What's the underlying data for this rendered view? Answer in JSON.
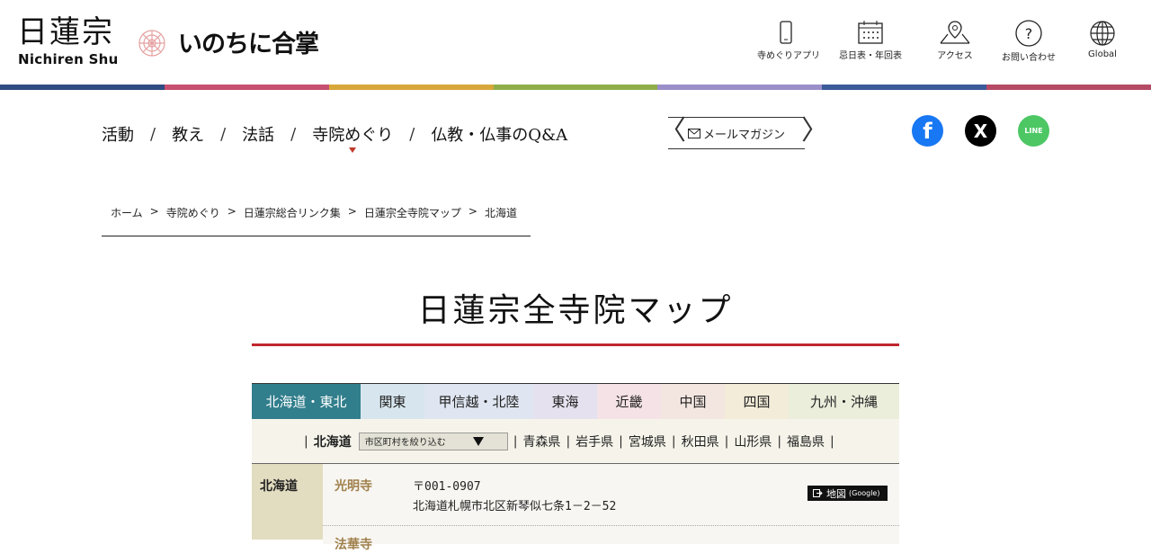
{
  "header": {
    "logo_jp": "日蓮宗",
    "logo_en": "Nichiren Shu",
    "tagline": "いのちに合掌",
    "nav": [
      {
        "label": "寺めぐりアプリ",
        "icon": "smartphone-icon"
      },
      {
        "label": "忌日表・年回表",
        "icon": "calendar-icon"
      },
      {
        "label": "アクセス",
        "icon": "map-pin-icon"
      },
      {
        "label": "お問い合わせ",
        "icon": "question-icon"
      },
      {
        "label": "Global",
        "icon": "globe-icon"
      }
    ]
  },
  "stripe_colors": [
    "#2f4b82",
    "#c6506f",
    "#d8a73a",
    "#8fae4a",
    "#9b8fc9",
    "#3a5a9a",
    "#b54a64"
  ],
  "mainnav": {
    "items": [
      "活動",
      "教え",
      "法話",
      "寺院めぐり",
      "仏教・仏事のQ&A"
    ],
    "separator": "/",
    "mail_magazine": "メールマガジン"
  },
  "social": [
    {
      "name": "facebook",
      "glyph": "f",
      "color": "#1877f2"
    },
    {
      "name": "x",
      "glyph": "X",
      "color": "#000000"
    },
    {
      "name": "line",
      "glyph": "LINE",
      "color": "#4cc764"
    }
  ],
  "breadcrumb": [
    "ホーム",
    "寺院めぐり",
    "日蓮宗総合リンク集",
    "日蓮宗全寺院マップ",
    "北海道"
  ],
  "page_title": "日蓮宗全寺院マップ",
  "tabs": [
    {
      "label": "北海道・東北",
      "bg": "#317e8c",
      "active": true
    },
    {
      "label": "関東",
      "bg": "#d7e6ee"
    },
    {
      "label": "甲信越・北陸",
      "bg": "#dfe6f1"
    },
    {
      "label": "東海",
      "bg": "#e6e1ef"
    },
    {
      "label": "近畿",
      "bg": "#f4e2e6"
    },
    {
      "label": "中国",
      "bg": "#f3e6e0"
    },
    {
      "label": "四国",
      "bg": "#f3ecd9"
    },
    {
      "label": "九州・沖縄",
      "bg": "#eaeedb"
    }
  ],
  "prefbar": {
    "current": "北海道",
    "select_placeholder": "市区町村を絞り込む",
    "prefs": [
      "青森県",
      "岩手県",
      "宮城県",
      "秋田県",
      "山形県",
      "福島県"
    ]
  },
  "results": {
    "pref": "北海道",
    "entries": [
      {
        "name": "光明寺",
        "zip": "〒001-0907",
        "address": "北海道札幌市北区新琴似七条1－2－52",
        "map_label": "地図",
        "map_sub": "(Google)"
      }
    ],
    "next_name": "法華寺"
  }
}
